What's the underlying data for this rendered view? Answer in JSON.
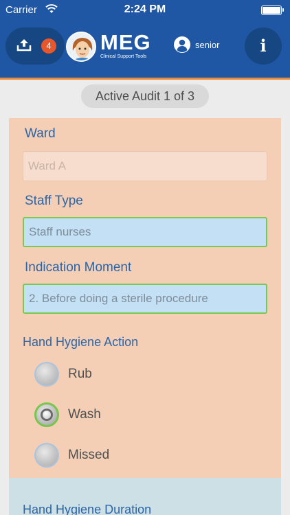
{
  "status": {
    "carrier": "Carrier",
    "time": "2:24 PM"
  },
  "header": {
    "badge_count": "4",
    "logo_name": "MEG",
    "logo_sub": "Clinical Support Tools",
    "user": "senior",
    "info": "i"
  },
  "audit": {
    "label": "Active Audit 1 of 3"
  },
  "form": {
    "ward": {
      "label": "Ward",
      "placeholder": "Ward A"
    },
    "staff_type": {
      "label": "Staff Type",
      "value": "Staff nurses"
    },
    "indication": {
      "label": "Indication Moment",
      "value": "2. Before doing a sterile procedure"
    },
    "action": {
      "label": "Hand Hygiene Action",
      "options": [
        "Rub",
        "Wash",
        "Missed"
      ],
      "selected": "Wash"
    },
    "duration_label": "Hand Hygiene Duration"
  },
  "colors": {
    "header": "#1f57a4",
    "accent": "#e88a3a",
    "panel": "#f4cfb5",
    "field_active": "#c3e0f4",
    "valid_border": "#7ac84f",
    "label": "#2a65a8"
  }
}
